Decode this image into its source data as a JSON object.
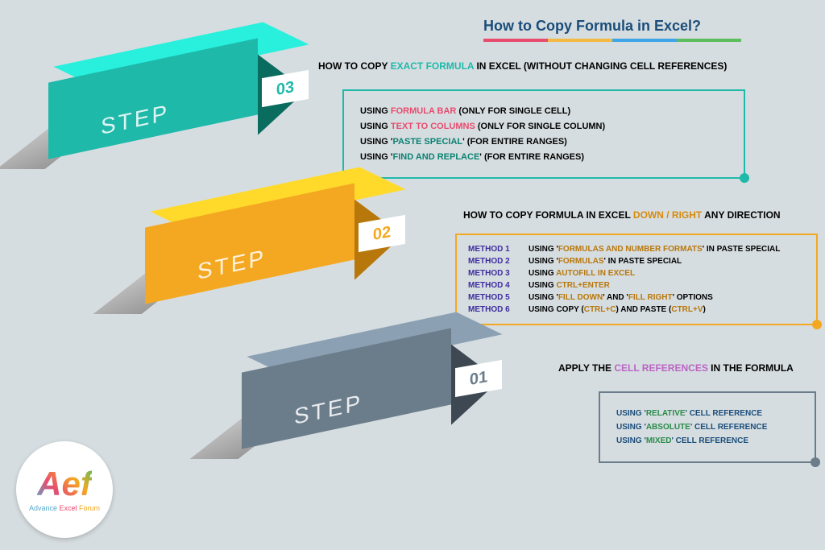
{
  "title": "How to Copy Formula in Excel?",
  "steps": {
    "s3": {
      "num": "03",
      "label": "STEP",
      "heading_pre": "HOW TO COPY ",
      "heading_hl": "EXACT FORMULA",
      "heading_post": " IN EXCEL (WITHOUT CHANGING CELL REFERENCES)",
      "items": [
        {
          "pre": "USING ",
          "hl": "FORMULA BAR",
          "post": " (ONLY FOR SINGLE CELL)",
          "cls": "pink"
        },
        {
          "pre": "USING ",
          "hl": "TEXT TO COLUMNS",
          "post": " (ONLY FOR SINGLE COLUMN)",
          "cls": "pink"
        },
        {
          "pre": "USING '",
          "hl": "PASTE SPECIAL",
          "post": "' (FOR ENTIRE RANGES)",
          "cls": "teal"
        },
        {
          "pre": "USING '",
          "hl": "FIND AND REPLACE",
          "post": "' (FOR ENTIRE RANGES)",
          "cls": "teal"
        }
      ]
    },
    "s2": {
      "num": "02",
      "label": "STEP",
      "heading_pre": "HOW TO COPY FORMULA IN EXCEL ",
      "heading_hl": "DOWN / RIGHT",
      "heading_post": " ANY DIRECTION",
      "methods": [
        {
          "m": "METHOD 1",
          "pre": "USING '",
          "hl": "FORMULAS AND NUMBER FORMATS",
          "post": "' IN PASTE SPECIAL"
        },
        {
          "m": "METHOD 2",
          "pre": "USING '",
          "hl": "FORMULAS",
          "post": "' IN PASTE SPECIAL"
        },
        {
          "m": "METHOD 3",
          "pre": "USING ",
          "hl": "AUTOFILL IN EXCEL",
          "post": ""
        },
        {
          "m": "METHOD 4",
          "pre": "USING ",
          "hl": "CTRL+ENTER",
          "post": ""
        },
        {
          "m": "METHOD 5",
          "pre": "USING '",
          "hl": "FILL DOWN",
          "mid": "' AND '",
          "hl2": "FILL RIGHT",
          "post": "' OPTIONS"
        },
        {
          "m": "METHOD 6",
          "pre": "USING COPY (",
          "hl": "CTRL+C",
          "mid": ") AND PASTE (",
          "hl2": "CTRL+V",
          "post": ")"
        }
      ]
    },
    "s1": {
      "num": "01",
      "label": "STEP",
      "heading_pre": "APPLY THE ",
      "heading_hl": "CELL REFERENCES",
      "heading_post": " IN THE FORMULA",
      "items": [
        {
          "pre": "USING '",
          "hl": "RELATIVE",
          "post": "' CELL REFERENCE"
        },
        {
          "pre": "USING '",
          "hl": "ABSOLUTE",
          "post": "' CELL REFERENCE"
        },
        {
          "pre": "USING '",
          "hl": "MIXED",
          "post": "' CELL REFERENCE"
        }
      ]
    }
  },
  "logo": {
    "brand_a": "Advance ",
    "brand_e": "Excel ",
    "brand_f": "Forum",
    "icon": "Aef"
  }
}
